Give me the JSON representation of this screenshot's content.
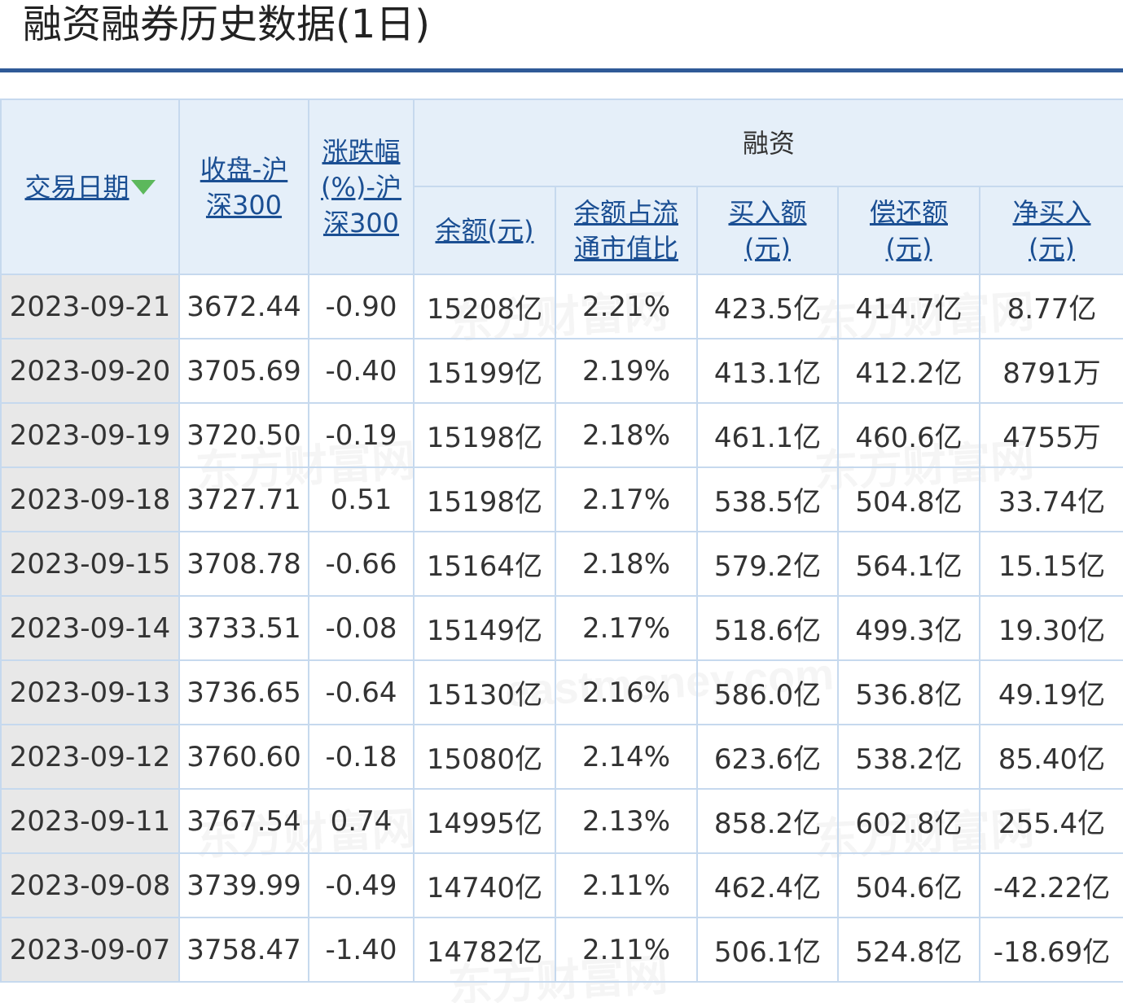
{
  "page": {
    "title": "融资融券历史数据(1日)",
    "watermark_cn": "东方财富网",
    "watermark_en": "eastmoney.com"
  },
  "colors": {
    "accent": "#2f5a97",
    "header_bg": "#e5eff9",
    "border": "#c6d9ee",
    "link": "#1b4f93",
    "up": "#e0161b",
    "down": "#1a9418",
    "date_bg": "#e8e8e8"
  },
  "table": {
    "headers": {
      "date": "交易日期",
      "close": "收盘-沪深300",
      "change": "涨跌幅(%)-沪深300",
      "group": "融资",
      "balance": "余额(元)",
      "ratio": "余额占流通市值比",
      "buy": "买入额(元)",
      "repay": "偿还额(元)",
      "net": "净买入(元)"
    },
    "sort_icon": "sort-down-arrow-icon",
    "rows": [
      {
        "date": "2023-09-21",
        "close": "3672.44",
        "change": "-0.90",
        "balance": "15208亿",
        "ratio": "2.21%",
        "buy": "423.5亿",
        "repay": "414.7亿",
        "net": "8.77亿",
        "dir": "down",
        "net_dir": "up"
      },
      {
        "date": "2023-09-20",
        "close": "3705.69",
        "change": "-0.40",
        "balance": "15199亿",
        "ratio": "2.19%",
        "buy": "413.1亿",
        "repay": "412.2亿",
        "net": "8791万",
        "dir": "down",
        "net_dir": "up"
      },
      {
        "date": "2023-09-19",
        "close": "3720.50",
        "change": "-0.19",
        "balance": "15198亿",
        "ratio": "2.18%",
        "buy": "461.1亿",
        "repay": "460.6亿",
        "net": "4755万",
        "dir": "down",
        "net_dir": "up"
      },
      {
        "date": "2023-09-18",
        "close": "3727.71",
        "change": "0.51",
        "balance": "15198亿",
        "ratio": "2.17%",
        "buy": "538.5亿",
        "repay": "504.8亿",
        "net": "33.74亿",
        "dir": "up",
        "net_dir": "up"
      },
      {
        "date": "2023-09-15",
        "close": "3708.78",
        "change": "-0.66",
        "balance": "15164亿",
        "ratio": "2.18%",
        "buy": "579.2亿",
        "repay": "564.1亿",
        "net": "15.15亿",
        "dir": "down",
        "net_dir": "up"
      },
      {
        "date": "2023-09-14",
        "close": "3733.51",
        "change": "-0.08",
        "balance": "15149亿",
        "ratio": "2.17%",
        "buy": "518.6亿",
        "repay": "499.3亿",
        "net": "19.30亿",
        "dir": "down",
        "net_dir": "up"
      },
      {
        "date": "2023-09-13",
        "close": "3736.65",
        "change": "-0.64",
        "balance": "15130亿",
        "ratio": "2.16%",
        "buy": "586.0亿",
        "repay": "536.8亿",
        "net": "49.19亿",
        "dir": "down",
        "net_dir": "up"
      },
      {
        "date": "2023-09-12",
        "close": "3760.60",
        "change": "-0.18",
        "balance": "15080亿",
        "ratio": "2.14%",
        "buy": "623.6亿",
        "repay": "538.2亿",
        "net": "85.40亿",
        "dir": "down",
        "net_dir": "up"
      },
      {
        "date": "2023-09-11",
        "close": "3767.54",
        "change": "0.74",
        "balance": "14995亿",
        "ratio": "2.13%",
        "buy": "858.2亿",
        "repay": "602.8亿",
        "net": "255.4亿",
        "dir": "up",
        "net_dir": "up"
      },
      {
        "date": "2023-09-08",
        "close": "3739.99",
        "change": "-0.49",
        "balance": "14740亿",
        "ratio": "2.11%",
        "buy": "462.4亿",
        "repay": "504.6亿",
        "net": "-42.22亿",
        "dir": "down",
        "net_dir": "down"
      },
      {
        "date": "2023-09-07",
        "close": "3758.47",
        "change": "-1.40",
        "balance": "14782亿",
        "ratio": "2.11%",
        "buy": "506.1亿",
        "repay": "524.8亿",
        "net": "-18.69亿",
        "dir": "down",
        "net_dir": "down"
      }
    ]
  }
}
